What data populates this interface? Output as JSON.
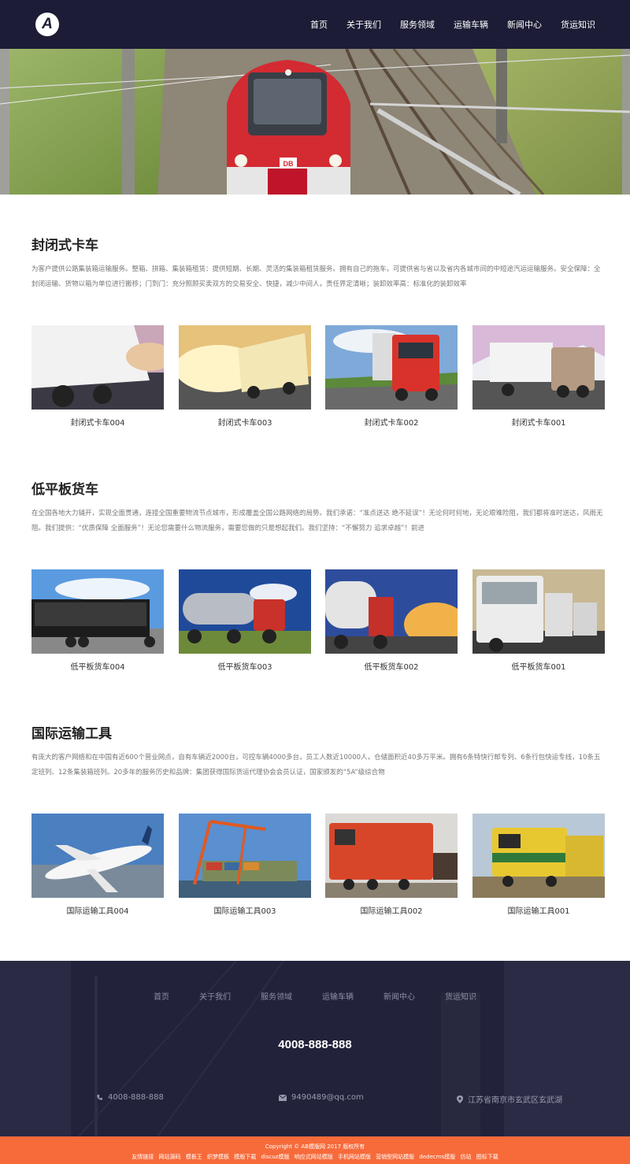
{
  "brand": {
    "logo_letter": "A"
  },
  "nav": [
    {
      "label": "首页"
    },
    {
      "label": "关于我们"
    },
    {
      "label": "服务领域"
    },
    {
      "label": "运输车辆"
    },
    {
      "label": "新闻中心"
    },
    {
      "label": "货运知识"
    }
  ],
  "sections": [
    {
      "title": "封闭式卡车",
      "desc": "为客户提供公路集装箱运输服务。整箱、拼箱、集装箱租赁：提供短期、长期、灵活的集装箱租赁服务。拥有自己的拖车，可提供省与省以及省内各城市间的中短途汽运运输服务。安全保障：全封闭运输、货物以箱为单位进行搬移；门到门：充分照顾买卖双方的交易安全、快捷，减少中间人，责任界定清晰；装卸效率高：标准化的装卸效率",
      "items": [
        {
          "caption": "封闭式卡车004"
        },
        {
          "caption": "封闭式卡车003"
        },
        {
          "caption": "封闭式卡车002"
        },
        {
          "caption": "封闭式卡车001"
        }
      ]
    },
    {
      "title": "低平板货车",
      "desc": "在全国各地大力铺开，实现全面贯通，连接全国重要物流节点城市，形成覆盖全国公路网络的局势。我们承诺：“准点送达 绝不延误”！无论何时何地，无论艰难险阻，我们都将准时送达，风雨无阻。我们提供：“优质保障 全面服务”！无论您需要什么物流服务，需要您做的只是想起我们。我们坚持：“不懈努力 追求卓越”！前进",
      "items": [
        {
          "caption": "低平板货车004"
        },
        {
          "caption": "低平板货车003"
        },
        {
          "caption": "低平板货车002"
        },
        {
          "caption": "低平板货车001"
        }
      ]
    },
    {
      "title": "国际运输工具",
      "desc": "有庞大的客户网络和在中国有近600个营业网点，自有车辆近2000台，可控车辆4000多台，员工人数近10000人，仓储面积近40多万平米。拥有6条特快行邮专列、6条行包快运专线，10条五定班列、12条集装箱班列。20多年的服务历史和品牌：集团获得国际货运代理协会会员认证，国家颁发的“5A”级综合物",
      "items": [
        {
          "caption": "国际运输工具004"
        },
        {
          "caption": "国际运输工具003"
        },
        {
          "caption": "国际运输工具002"
        },
        {
          "caption": "国际运输工具001"
        }
      ]
    }
  ],
  "footer": {
    "nav": [
      {
        "label": "首页"
      },
      {
        "label": "关于我们"
      },
      {
        "label": "服务领域"
      },
      {
        "label": "运输车辆"
      },
      {
        "label": "新闻中心"
      },
      {
        "label": "货运知识"
      }
    ],
    "hotline": "4008-888-888",
    "phone": "4008-888-888",
    "email": "9490489@qq.com",
    "address": "江苏省南京市玄武区玄武湖",
    "copyright": "Copyright © AB模版网 2017 版权所有",
    "links_label": "友情链接",
    "links": [
      "网站源码",
      "模板王",
      "织梦模板",
      "模版下载",
      "discuz模版",
      "响应式网站模版",
      "手机网站模版",
      "营销型网站模版",
      "dedecms模版",
      "仿站",
      "图标下载"
    ]
  },
  "colors": {
    "header_bg": "#1c1c36",
    "footer_bg": "#22223a",
    "accent": "#f76b3b"
  }
}
